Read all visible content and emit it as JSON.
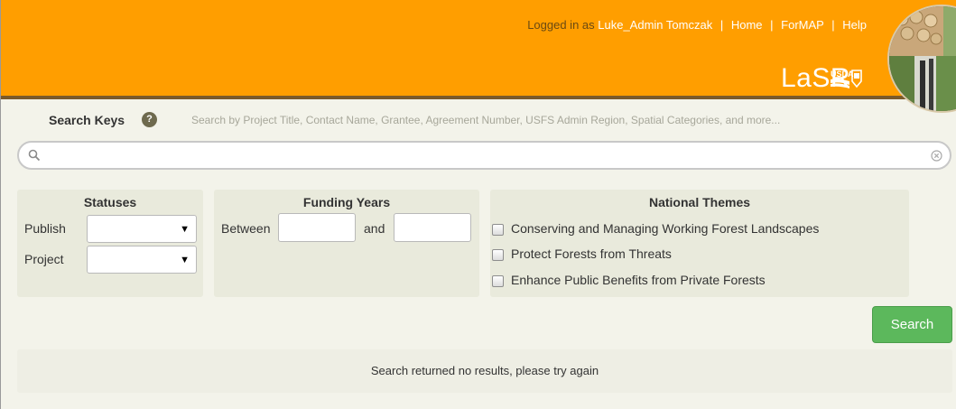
{
  "header": {
    "logged_in_prefix": "Logged in as",
    "user_name": "Luke_Admin Tomczak",
    "nav": [
      "Home",
      "ForMAP",
      "Help"
    ],
    "brand": "LaSR",
    "colors": {
      "header_bg": "#ff9e00",
      "button_green": "#5cb85c"
    }
  },
  "search": {
    "label": "Search Keys",
    "help_icon": "?",
    "hint": "Search by Project Title, Contact Name, Grantee, Agreement Number, USFS Admin Region, Spatial Categories, and more...",
    "value": "",
    "placeholder": ""
  },
  "statuses": {
    "title": "Statuses",
    "publish_label": "Publish",
    "project_label": "Project",
    "publish_value": "",
    "project_value": ""
  },
  "funding": {
    "title": "Funding Years",
    "between_label": "Between",
    "and_label": "and",
    "from_value": "",
    "to_value": ""
  },
  "themes": {
    "title": "National Themes",
    "items": [
      {
        "label": "Conserving and Managing Working Forest Landscapes",
        "checked": false
      },
      {
        "label": "Protect Forests from Threats",
        "checked": false
      },
      {
        "label": "Enhance Public Benefits from Private Forests",
        "checked": false
      }
    ]
  },
  "search_button": "Search",
  "results": {
    "message": "Search returned no results, please try again"
  }
}
